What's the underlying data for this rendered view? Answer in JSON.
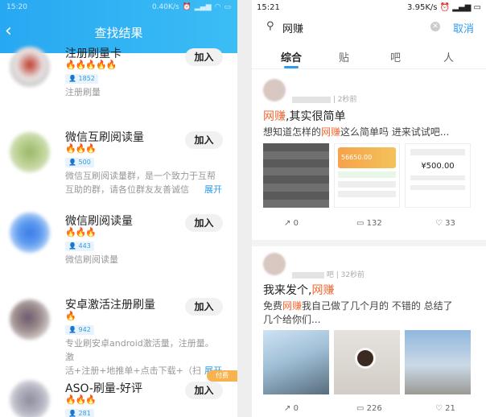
{
  "left_screen": {
    "status": {
      "time": "15:20",
      "speed": "0.40K/s"
    },
    "title": "查找结果",
    "groups": [
      {
        "name": "注册刷量卡",
        "members": "1852",
        "desc": "注册刷量",
        "join": "加入"
      },
      {
        "name": "微信互刷阅读量",
        "members": "500",
        "desc_line1": "微信互刷阅读量群，是一个致力于互帮",
        "desc_line2": "互助的群，请各位群友友善诚信",
        "more": "展开",
        "join": "加入"
      },
      {
        "name": "微信刷阅读量",
        "members": "443",
        "desc": "微信刷阅读量",
        "join": "加入"
      },
      {
        "name": "安卓激活注册刷量",
        "members": "942",
        "desc_line1": "专业刷安卓android激活量，注册量。激",
        "desc_line2": "活+注册+地推单+点击下载+（扫",
        "more": "展开",
        "join": "加入"
      },
      {
        "name": "ASO-刷量-好评",
        "members": "281",
        "join": "加入",
        "paid_tag": "付费"
      }
    ],
    "colors": {
      "header": "#27a8f2",
      "flame": "#f5a623"
    }
  },
  "right_screen": {
    "status": {
      "time": "15:21",
      "speed": "3.95K/s"
    },
    "search": {
      "query": "网赚",
      "cancel": "取消"
    },
    "tabs": [
      "综合",
      "贴",
      "吧",
      "人"
    ],
    "active_tab": "综合",
    "posts": [
      {
        "meta": "| 2秒前",
        "title_hl": "网赚",
        "title_rest": ",其实很简单",
        "text_a": "想知道怎样的",
        "text_hl": "网赚",
        "text_b": "这么简单吗 进来试试吧...",
        "img2_amount": "56650.00",
        "img3_amount": "¥500.00",
        "shares": "0",
        "comments": "132",
        "likes": "33"
      },
      {
        "meta": "吧 | 32秒前",
        "title_a": "我来发个,",
        "title_hl": "网赚",
        "text_a": "免费",
        "text_hl": "网赚",
        "text_b": "我自己做了几个月的 不错的 总结了",
        "text_line2": "几个给你们...",
        "shares": "0",
        "comments": "226",
        "likes": "21"
      }
    ],
    "colors": {
      "highlight": "#ef6a36",
      "accent": "#2d9cf0"
    }
  }
}
